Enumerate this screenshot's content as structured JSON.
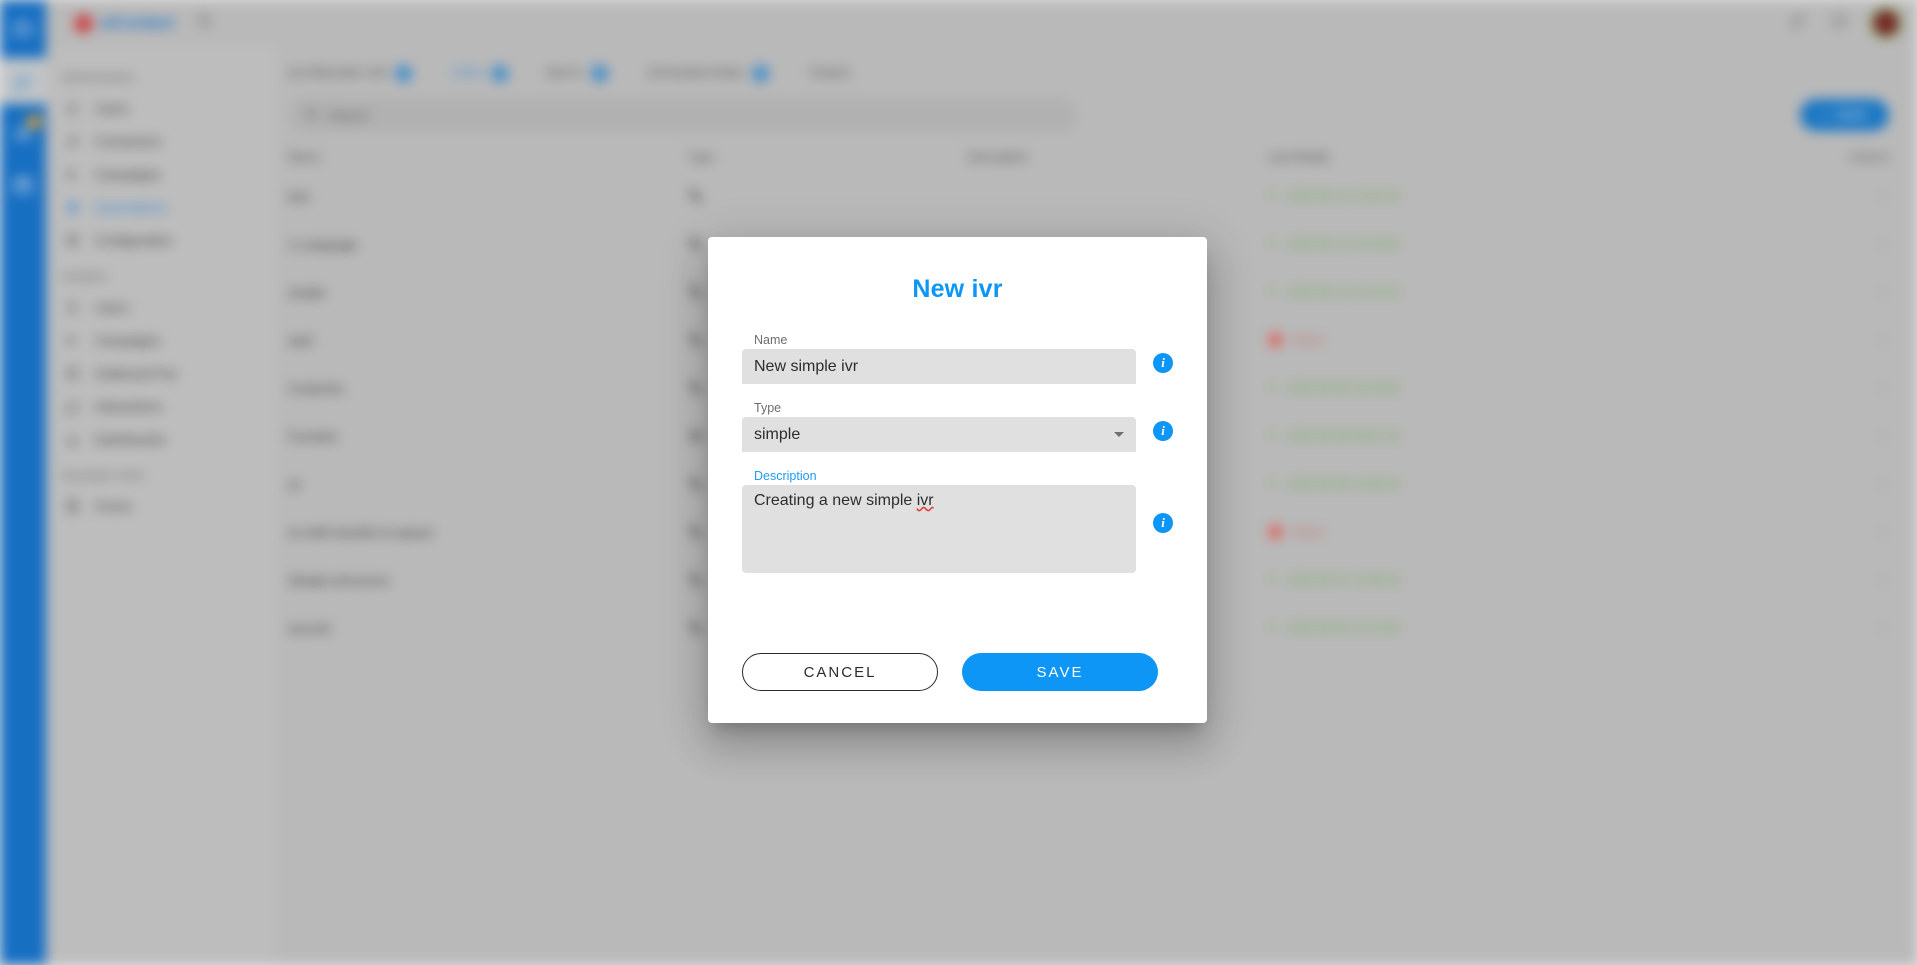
{
  "app": {
    "logo_text": "wContact",
    "rail": [
      {
        "name": "apps-icon",
        "badge": ""
      },
      {
        "name": "chat-icon",
        "badge": ""
      },
      {
        "name": "bell-icon",
        "badge": "2"
      },
      {
        "name": "calendar-icon",
        "badge": ""
      }
    ],
    "topbar": {
      "search_icon": "search-icon",
      "edit_icon": "edit-icon",
      "bell_icon": "notifications-icon",
      "avatar": "user-avatar"
    }
  },
  "sidebar": {
    "sections": [
      {
        "title": "Administration",
        "items": [
          {
            "label": "Users",
            "icon": "user-icon",
            "active": false
          },
          {
            "label": "Connectors",
            "icon": "plug-icon",
            "active": false
          },
          {
            "label": "Campaigns",
            "icon": "megaphone-icon",
            "active": false
          },
          {
            "label": "Automations",
            "icon": "automation-icon",
            "active": true
          },
          {
            "label": "Configuration",
            "icon": "gear-icon",
            "active": false
          }
        ]
      },
      {
        "title": "Analytics",
        "items": [
          {
            "label": "Users",
            "icon": "user-icon",
            "active": false
          },
          {
            "label": "Campaigns",
            "icon": "megaphone-icon",
            "active": false
          },
          {
            "label": "Outbound Fax",
            "icon": "fax-icon",
            "active": false
          },
          {
            "label": "Interactions",
            "icon": "chat-icon",
            "active": false
          },
          {
            "label": "Dashboards",
            "icon": "chart-icon",
            "active": false
          }
        ]
      },
      {
        "title": "Developer Tools",
        "items": [
          {
            "label": "Forms",
            "icon": "form-icon",
            "active": false
          }
        ]
      }
    ]
  },
  "main": {
    "tabs": [
      {
        "label": "OUTBOUND IVR",
        "badge": "3",
        "active": false
      },
      {
        "label": "IVRS",
        "badge": "9",
        "active": true
      },
      {
        "label": "BOTS",
        "badge": "4",
        "active": false
      },
      {
        "label": "INTEGRATIONS",
        "badge": "5",
        "active": false
      },
      {
        "label": "TASKS",
        "badge": "",
        "active": false
      }
    ],
    "search": {
      "placeholder": "Search",
      "value": ""
    },
    "new_button": {
      "label": "NEW",
      "icon": "plus-icon"
    },
    "table": {
      "columns": [
        "Name",
        "Type",
        "Description",
        "Last Modify",
        "Actions"
      ],
      "rows": [
        {
          "name": "test",
          "type": "phone-icon",
          "description": "",
          "modified": "2023-05-12 13:42:18",
          "status": "ok"
        },
        {
          "name": "1-Language",
          "type": "phone-icon",
          "description": "",
          "modified": "2023-05-10 10:18:04",
          "status": "ok"
        },
        {
          "name": "simple",
          "type": "phone-icon",
          "description": "",
          "modified": "2023-05-10 11:02:43",
          "status": "ok"
        },
        {
          "name": "start",
          "type": "phone-icon",
          "description": "",
          "modified": "Never",
          "status": "never"
        },
        {
          "name": "Customer",
          "type": "phone-icon",
          "description": "",
          "modified": "2023-05-09 16:24:05",
          "status": "ok"
        },
        {
          "name": "Function",
          "type": "bot-icon",
          "description": "",
          "modified": "2023-05-09 09:51:33",
          "status": "ok"
        },
        {
          "name": "ivr",
          "type": "phone-icon",
          "description": "",
          "modified": "2023-05-08 14:08:19",
          "status": "ok"
        },
        {
          "name": "ivr-with-transfer-to-queue",
          "type": "phone-icon",
          "description": "",
          "modified": "Never",
          "status": "never"
        },
        {
          "name": "Simple-announce",
          "type": "phone-icon",
          "description": "",
          "modified": "2023-05-07 12:40:16",
          "status": "ok"
        },
        {
          "name": "second",
          "type": "phone-icon",
          "description": "",
          "modified": "2023-05-05 10:13:58",
          "status": "ok"
        }
      ],
      "action_icon": "more-vertical-icon"
    }
  },
  "modal": {
    "title": "New ivr",
    "fields": {
      "name": {
        "label": "Name",
        "value": "New simple ivr",
        "placeholder": "",
        "info_icon": "info-icon"
      },
      "type": {
        "label": "Type",
        "value": "simple",
        "options": [
          "simple"
        ],
        "caret_icon": "chevron-down-icon",
        "info_icon": "info-icon"
      },
      "description": {
        "label": "Description",
        "value_prefix": "Creating a new simple ",
        "value_misspelled": "ivr",
        "placeholder": "",
        "info_icon": "info-icon",
        "focused": true
      }
    },
    "buttons": {
      "cancel": "CANCEL",
      "save": "SAVE"
    }
  },
  "colors": {
    "accent": "#0d96f5",
    "rail": "#1976cf",
    "status_ok": "#6fae4e",
    "status_never": "#d56a6a",
    "badge": "#f0a020"
  }
}
